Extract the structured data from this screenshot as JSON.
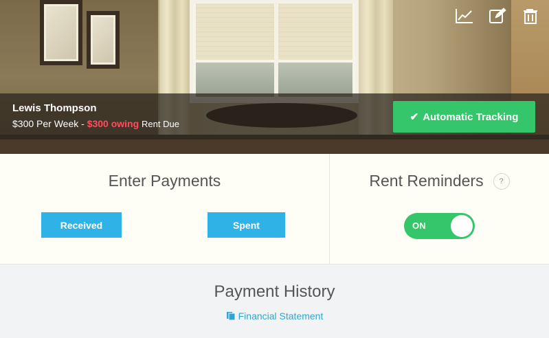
{
  "toolbar": {
    "icons": [
      "chart-icon",
      "edit-icon",
      "trash-icon"
    ]
  },
  "tenant": {
    "name": "Lewis Thompson",
    "rent": "$300 Per Week -",
    "owing": "$300 owing",
    "due": "Rent Due"
  },
  "tracking": {
    "label": "Automatic Tracking",
    "color": "#35c56a"
  },
  "payments": {
    "title": "Enter Payments",
    "received_label": "Received",
    "spent_label": "Spent",
    "button_color": "#2fb3e6"
  },
  "reminders": {
    "title": "Rent Reminders",
    "help": "?",
    "toggle_label": "ON",
    "toggle_state": true
  },
  "history": {
    "title": "Payment History",
    "statement_label": "Financial Statement"
  },
  "colors": {
    "accent_green": "#35c56a",
    "accent_blue": "#2fb3e6",
    "owing_red": "#ff4d5e",
    "link_blue": "#2fa6cf"
  }
}
